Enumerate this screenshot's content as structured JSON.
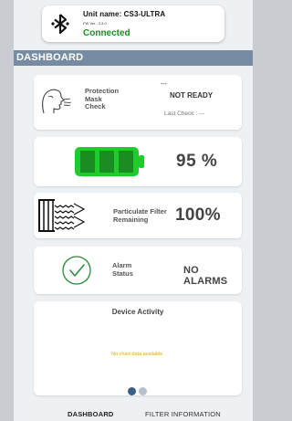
{
  "device": {
    "unit_name": "Unit name: CS3-ULTRA",
    "fw_version": "FW Ver : 3.3.0",
    "connection_status": "Connected",
    "status_color": "#1e8b24",
    "icon": "bluetooth-icon"
  },
  "header": {
    "title": "DASHBOARD"
  },
  "protection_mask": {
    "label_lines": [
      "Protection",
      "Mask",
      "Check"
    ],
    "placeholder": "---",
    "status": "NOT READY",
    "last_check": "Last Check : ---",
    "icon": "face-breath-icon"
  },
  "battery": {
    "percent_text": "95 %",
    "level": 0.95,
    "color": "#1fcc2c",
    "icon": "battery-icon"
  },
  "filter": {
    "label_lines": [
      "Particulate Filter",
      "Remaining"
    ],
    "percent_text": "100%",
    "icon": "filter-icon"
  },
  "alarm": {
    "label_lines": [
      "Alarm",
      "Status"
    ],
    "status": "NO ALARMS",
    "icon": "check-circle-icon"
  },
  "device_activity": {
    "title": "Device Activity",
    "empty_text": "No chart data available.",
    "pages": 2,
    "active_page": 1
  },
  "bottom_nav": {
    "items": [
      "DASHBOARD",
      "FILTER INFORMATION"
    ],
    "active": 0
  }
}
